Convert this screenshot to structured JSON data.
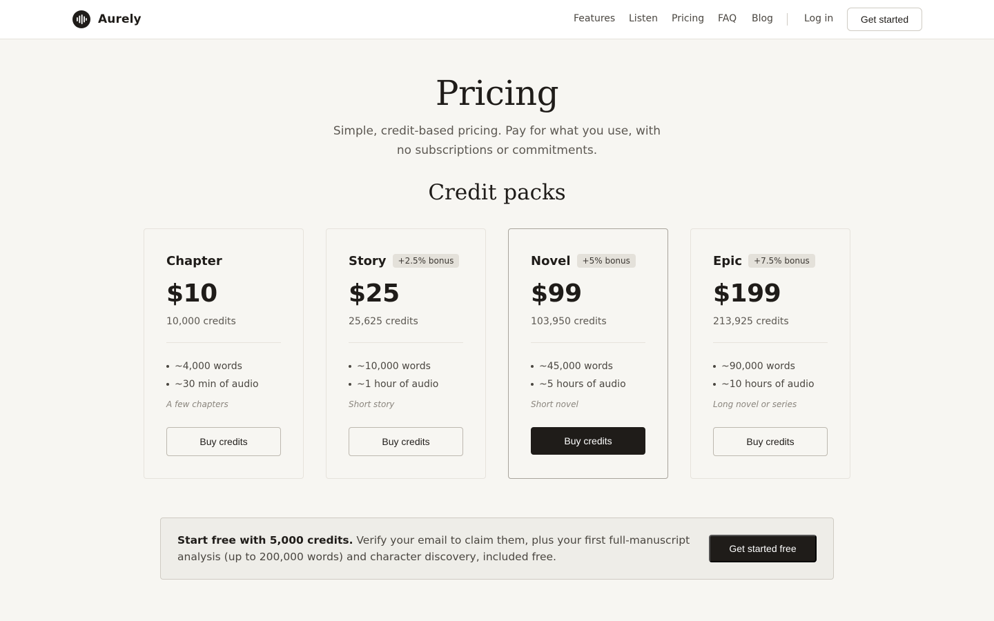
{
  "brand": {
    "name": "Aurely",
    "logo_icon": "soundwave-icon"
  },
  "nav": {
    "links": [
      "Features",
      "Listen",
      "Pricing",
      "FAQ",
      "Blog"
    ],
    "login": "Log in",
    "cta": "Get started"
  },
  "hero": {
    "title": "Pricing",
    "subtitle": "Simple, credit-based pricing. Pay for what you use, with no subscriptions or commitments."
  },
  "section": {
    "title": "Credit packs"
  },
  "packs": [
    {
      "name": "Chapter",
      "bonus": "",
      "price": "$10",
      "credits": "10,000 credits",
      "features": [
        "~4,000 words",
        "~30 min of audio"
      ],
      "note": "A few chapters",
      "button": "Buy credits",
      "featured": false
    },
    {
      "name": "Story",
      "bonus": "+2.5% bonus",
      "price": "$25",
      "credits": "25,625 credits",
      "features": [
        "~10,000 words",
        "~1 hour of audio"
      ],
      "note": "Short story",
      "button": "Buy credits",
      "featured": false
    },
    {
      "name": "Novel",
      "bonus": "+5% bonus",
      "price": "$99",
      "credits": "103,950 credits",
      "features": [
        "~45,000 words",
        "~5 hours of audio"
      ],
      "note": "Short novel",
      "button": "Buy credits",
      "featured": true
    },
    {
      "name": "Epic",
      "bonus": "+7.5% bonus",
      "price": "$199",
      "credits": "213,925 credits",
      "features": [
        "~90,000 words",
        "~10 hours of audio"
      ],
      "note": "Long novel or series",
      "button": "Buy credits",
      "featured": false
    }
  ],
  "banner": {
    "strong": "Start free with 5,000 credits.",
    "text": " Verify your email to claim them, plus your first full-manuscript analysis (up to 200,000 words) and character discovery, included free.",
    "button": "Get started free"
  },
  "colors": {
    "ink": "#1f1c19",
    "background": "#f7f6f2",
    "badge": "#e4e1da"
  }
}
